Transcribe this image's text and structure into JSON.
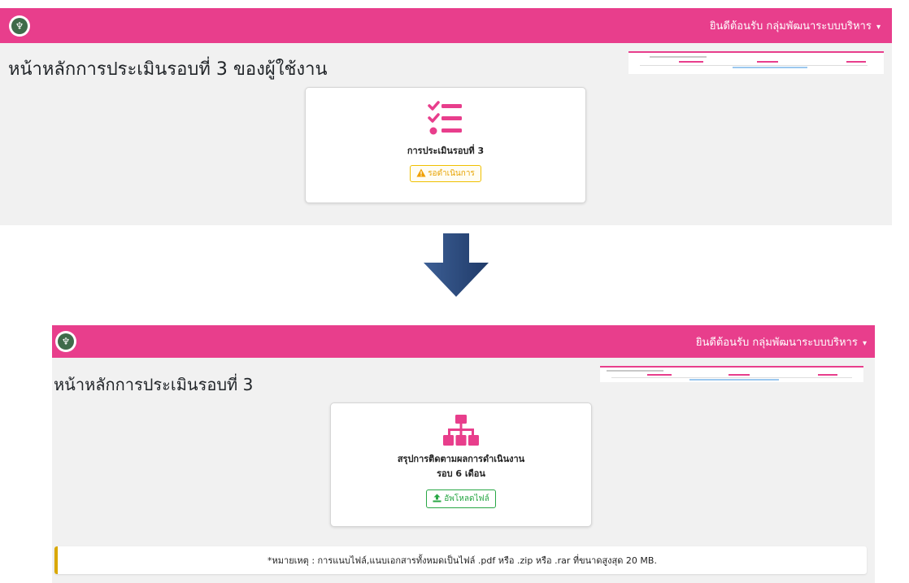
{
  "before": {
    "navbar": {
      "welcome_text": "ยินดีต้อนรับ กลุ่มพัฒนาระบบบริหาร",
      "logo_glyph": "♆"
    },
    "page_title": "หน้าหลักการประเมินรอบที่ 3 ของผู้ใช้งาน",
    "card": {
      "title": "การประเมินรอบที่ 3",
      "status_label": "รอดำเนินการ",
      "icon": "list-check-icon"
    }
  },
  "after": {
    "navbar": {
      "welcome_text": "ยินดีต้อนรับ กลุ่มพัฒนาระบบบริหาร",
      "logo_glyph": "♆"
    },
    "page_title": "หน้าหลักการประเมินรอบที่ 3",
    "card": {
      "title_line1": "สรุปการติดตามผลการดำเนินงาน",
      "title_line2": "รอบ 6 เดือน",
      "button_label": "อัพโหลดไฟล์",
      "icon": "sitemap-icon"
    },
    "note": "*หมายเหตุ : การแนบไฟล์,แนบเอกสารทั้งหมดเป็นไฟล์ .pdf หรือ .zip หรือ .rar ที่ขนาดสูงสุด 20 MB."
  },
  "colors": {
    "accent": "#e83e8c",
    "arrow": "#2c4a7a",
    "warning": "#f0c000",
    "success": "#28a745"
  }
}
